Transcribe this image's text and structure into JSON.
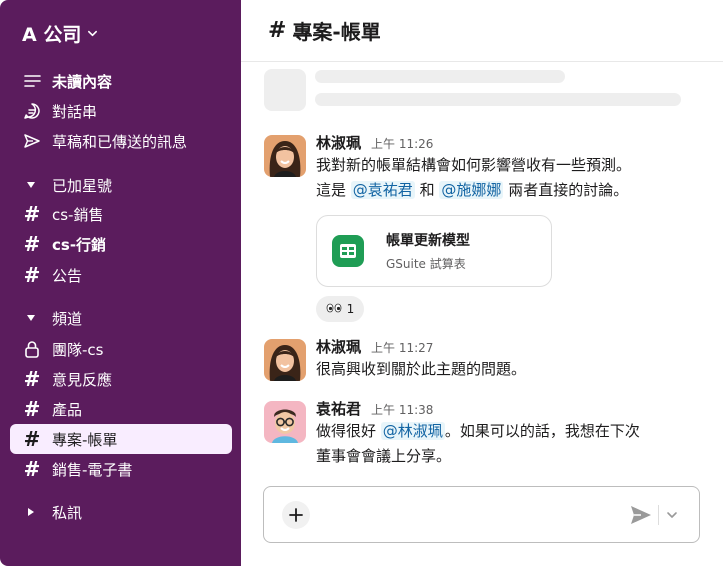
{
  "workspace": {
    "name": "A 公司"
  },
  "sidebar": {
    "nav": [
      {
        "label": "未讀內容",
        "icon": "unread-list-icon",
        "bold": true
      },
      {
        "label": "對話串",
        "icon": "threads-icon",
        "bold": false
      },
      {
        "label": "草稿和已傳送的訊息",
        "icon": "send-icon",
        "bold": false
      }
    ],
    "starred": {
      "label": "已加星號",
      "channels": [
        {
          "label": "cs-銷售",
          "bold": false
        },
        {
          "label": "cs-行銷",
          "bold": true
        },
        {
          "label": "公告",
          "bold": false
        }
      ]
    },
    "channels": {
      "label": "頻道",
      "items": [
        {
          "label": "團隊-cs",
          "icon": "lock-icon"
        },
        {
          "label": "意見反應",
          "icon": "hash-icon"
        },
        {
          "label": "產品",
          "icon": "hash-icon"
        },
        {
          "label": "專案-帳單",
          "icon": "hash-icon",
          "active": true
        },
        {
          "label": "銷售-電子書",
          "icon": "hash-icon"
        }
      ]
    },
    "dms": {
      "label": "私訊"
    }
  },
  "channel": {
    "hash": "#",
    "name": "專案-帳單"
  },
  "messages": [
    {
      "author": "林淑珮",
      "time": "上午 11:26",
      "line1": "我對新的帳單結構會如何影響營收有一些預測。",
      "line2_prefix": "這是",
      "mention1": "@袁祐君",
      "line2_mid": "和",
      "mention2": "@施娜娜",
      "line2_suffix": "兩者直接的討論。",
      "attachment": {
        "title": "帳單更新模型",
        "subtitle": "GSuite 試算表"
      },
      "reaction": {
        "emoji": "👀",
        "count": "1"
      }
    },
    {
      "author": "林淑珮",
      "time": "上午 11:27",
      "text": "很高興收到關於此主題的問題。"
    },
    {
      "author": "袁祐君",
      "time": "上午 11:38",
      "line1_prefix": "做得很好",
      "mention": "@林淑珮",
      "line1_suffix": "。如果可以的話，我想在下次",
      "line2": "董事會會議上分享。"
    }
  ],
  "colors": {
    "sidebar_bg": "#5b1c5d",
    "active_item_bg": "#f9edff",
    "mention": "#1264a3",
    "sheet_icon": "#1f9d55"
  }
}
